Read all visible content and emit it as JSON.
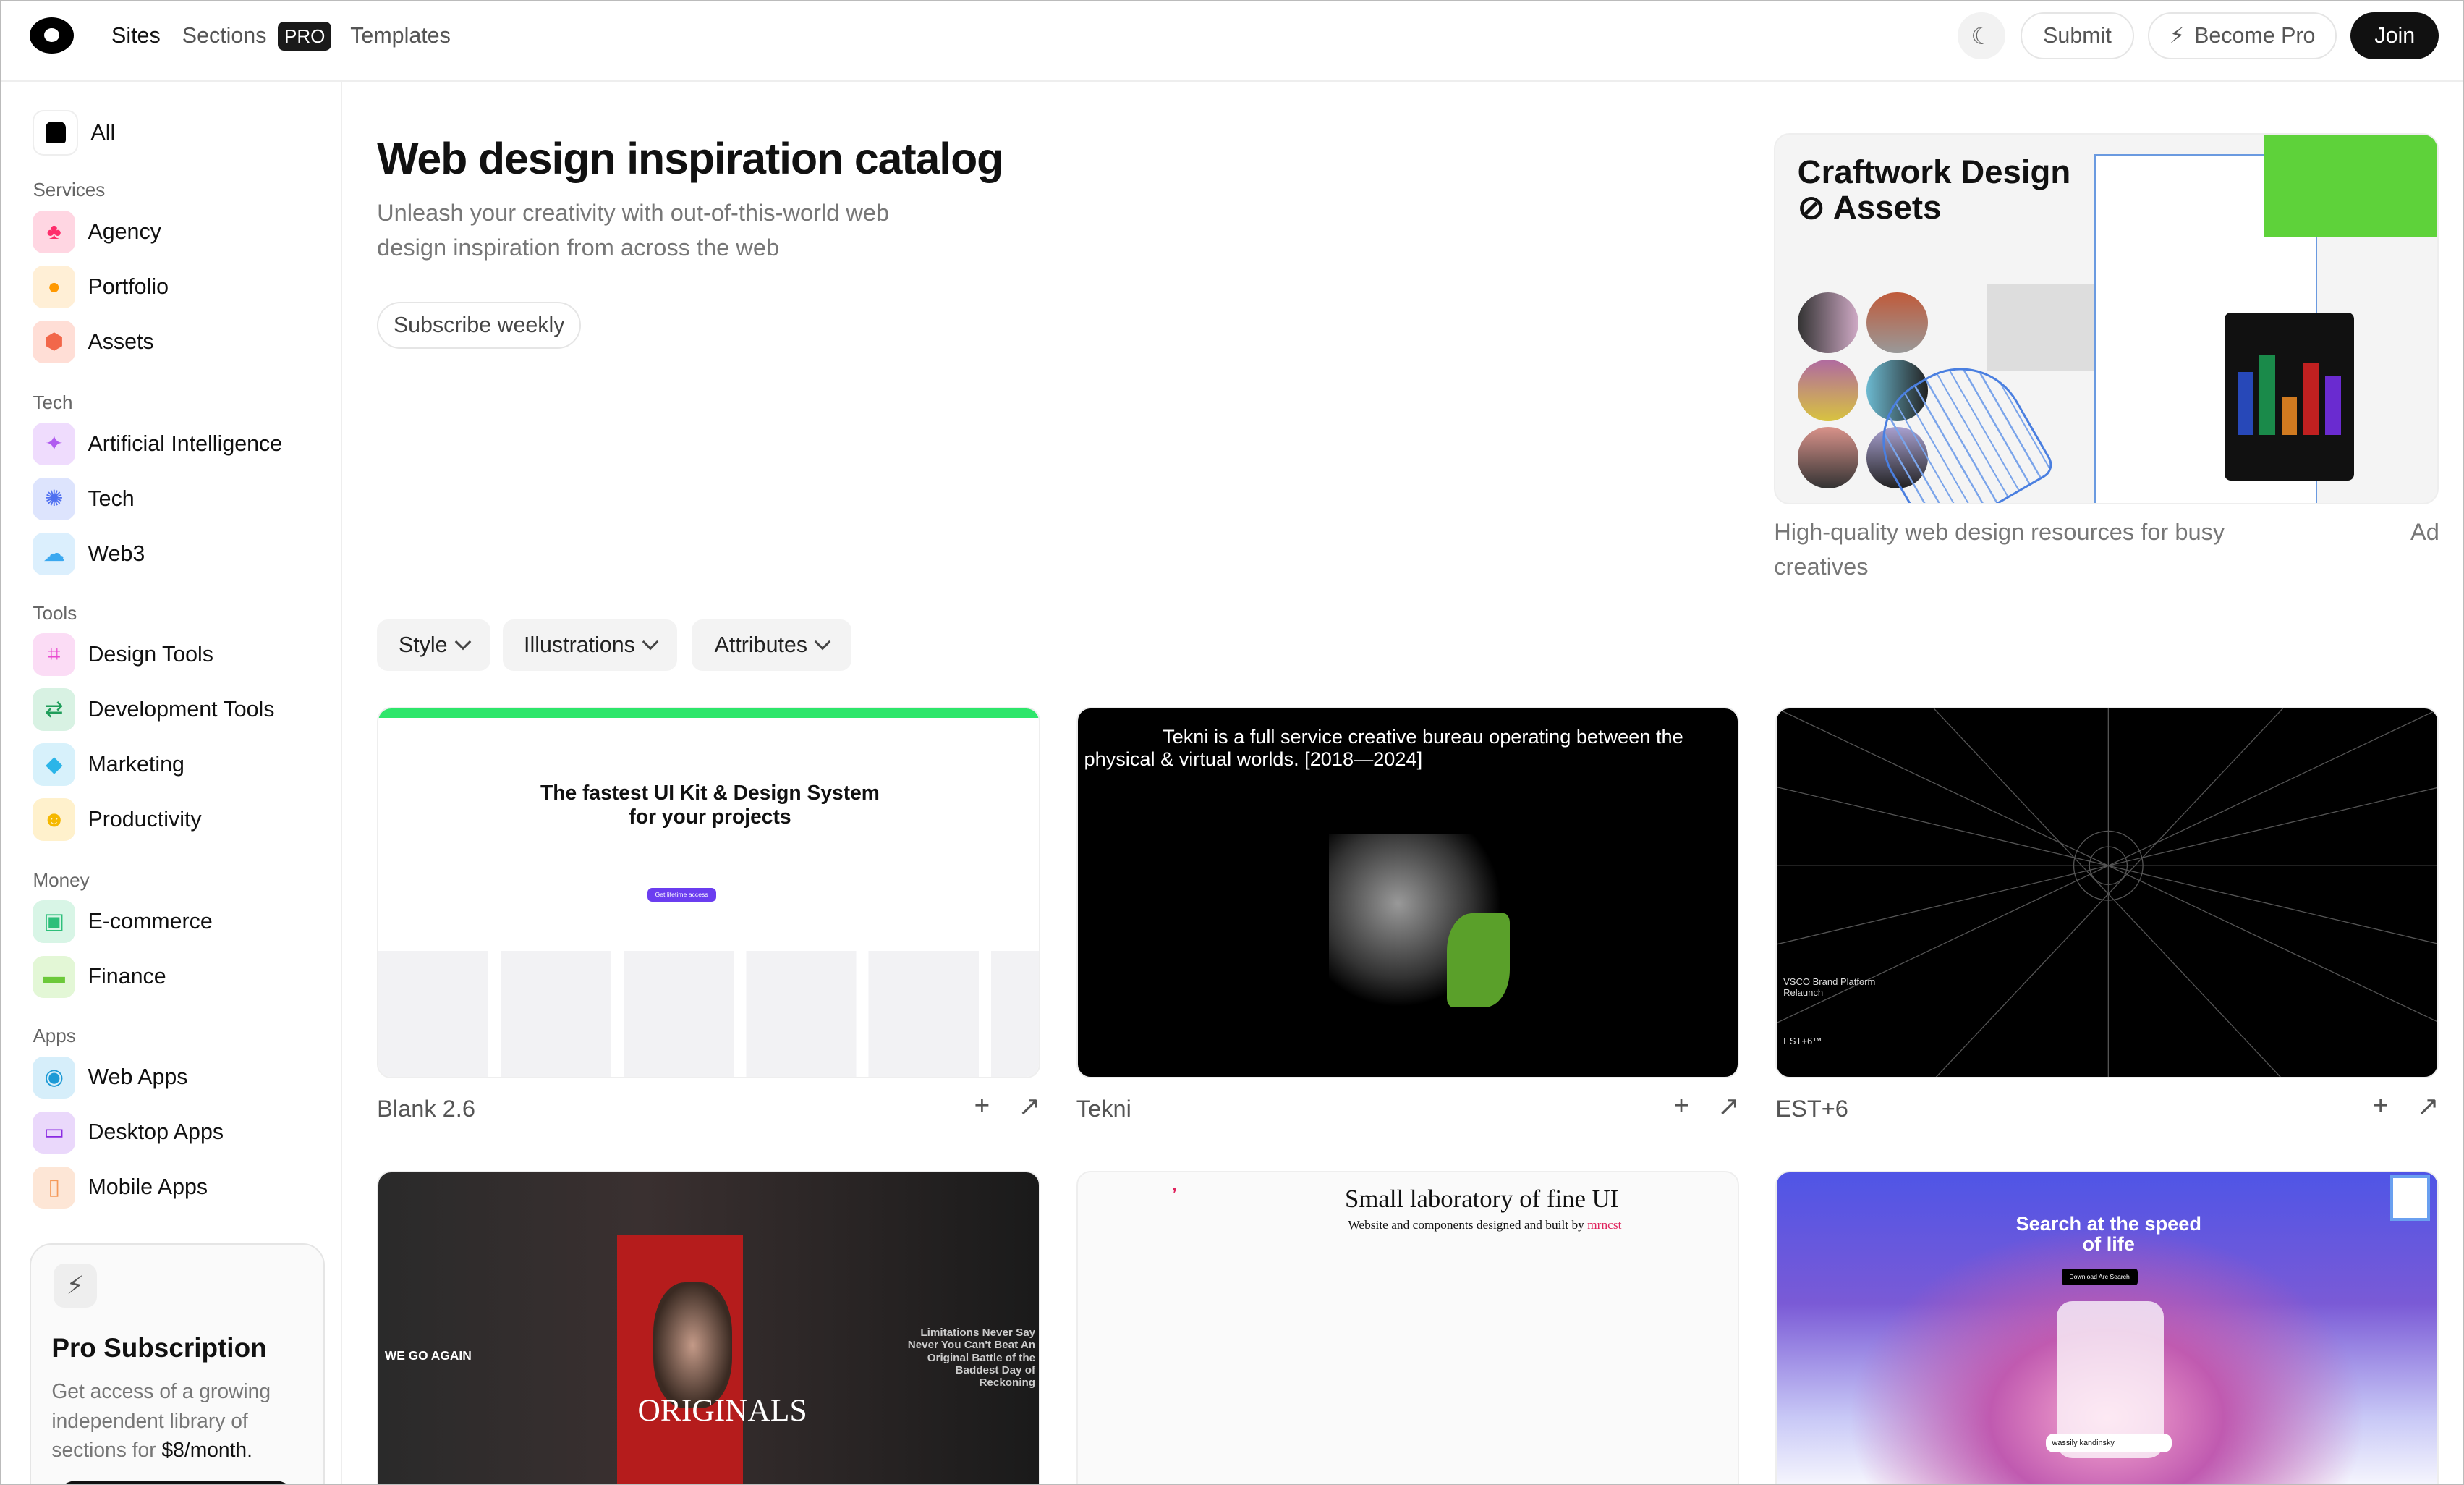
{
  "header": {
    "nav": [
      {
        "label": "Sites"
      },
      {
        "label": "Sections",
        "badge": "PRO"
      },
      {
        "label": "Templates"
      }
    ],
    "theme_icon": "moon-icon",
    "submit_label": "Submit",
    "become_pro_label": "Become Pro",
    "join_label": "Join"
  },
  "sidebar": {
    "all_label": "All",
    "groups": [
      {
        "title": "Services",
        "items": [
          {
            "label": "Agency",
            "color": "#ff2d6b",
            "bg": "#ffd6e2"
          },
          {
            "label": "Portfolio",
            "color": "#ff9800",
            "bg": "#ffefd6"
          },
          {
            "label": "Assets",
            "color": "#f2674a",
            "bg": "#ffded6"
          }
        ]
      },
      {
        "title": "Tech",
        "items": [
          {
            "label": "Artificial Intelligence",
            "color": "#b05cf0",
            "bg": "#efdcfd"
          },
          {
            "label": "Tech",
            "color": "#4f6ff0",
            "bg": "#dde4fd"
          },
          {
            "label": "Web3",
            "color": "#3aa8f0",
            "bg": "#dbeffd"
          }
        ]
      },
      {
        "title": "Tools",
        "items": [
          {
            "label": "Design Tools",
            "color": "#e94bd0",
            "bg": "#fbdcf5"
          },
          {
            "label": "Development Tools",
            "color": "#1f9d5a",
            "bg": "#d8f2e3"
          },
          {
            "label": "Marketing",
            "color": "#2bb5e8",
            "bg": "#d7f1fb"
          },
          {
            "label": "Productivity",
            "color": "#f5b800",
            "bg": "#fff1cc"
          }
        ]
      },
      {
        "title": "Money",
        "items": [
          {
            "label": "E-commerce",
            "color": "#2dbf7a",
            "bg": "#d8f5e6"
          },
          {
            "label": "Finance",
            "color": "#6cc93a",
            "bg": "#e3f7d6"
          }
        ]
      },
      {
        "title": "Apps",
        "items": [
          {
            "label": "Web Apps",
            "color": "#1c9ad6",
            "bg": "#d6eefa"
          },
          {
            "label": "Desktop Apps",
            "color": "#8a2be2",
            "bg": "#ead8fb"
          },
          {
            "label": "Mobile Apps",
            "color": "#f59a5a",
            "bg": "#fde6d6"
          }
        ]
      }
    ],
    "pro_card": {
      "title": "Pro Subscription",
      "text": "Get access of a growing independent library of sections for ",
      "price": "$8/month",
      "period_end": "."
    }
  },
  "main": {
    "title": "Web design inspiration catalog",
    "subtitle": "Unleash your creativity with out-of-this-world web design inspiration from across the web",
    "subscribe_label": "Subscribe weekly",
    "ad": {
      "brand": "Craftwork Design",
      "brand_suffix": "Assets",
      "caption": "High-quality web design resources for busy creatives",
      "tag": "Ad"
    },
    "filters": [
      {
        "label": "Style"
      },
      {
        "label": "Illustrations"
      },
      {
        "label": "Attributes"
      }
    ],
    "sites": [
      {
        "name": "Blank 2.6",
        "headline": "The fastest UI Kit & Design System for your projects",
        "cta": "Get lifetime access"
      },
      {
        "name": "Tekni",
        "headline": "Tekni is a full service creative bureau operating between the physical & virtual worlds. [2018—2024]"
      },
      {
        "name": "EST+6",
        "headline": "VSCO Brand Platform Relaunch",
        "sub": "EST+6™"
      },
      {
        "name": "",
        "headline": "ORIGINALS",
        "sub": "WE GO AGAIN",
        "side": "Limitations Never Say Never You Can't Beat An Original Battle of the Baddest Day of Reckoning"
      },
      {
        "name": "",
        "headline": "Small laboratory of fine UI",
        "sub": "Website and components designed and built by ",
        "author": "mrncst"
      },
      {
        "name": "",
        "headline": "Search at the speed of life",
        "cta": "Download Arc Search",
        "search": "wassily kandinsky"
      }
    ]
  }
}
